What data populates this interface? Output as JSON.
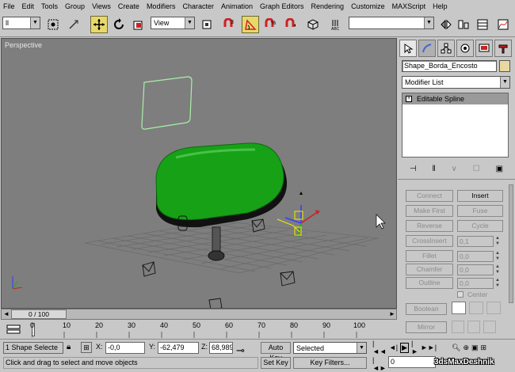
{
  "menu": [
    "File",
    "Edit",
    "Tools",
    "Group",
    "Views",
    "Create",
    "Modifiers",
    "Character",
    "Animation",
    "Graph Editors",
    "Rendering",
    "Customize",
    "MAXScript",
    "Help"
  ],
  "toolbar": {
    "selection_filter": "ll",
    "ref_coord": "View",
    "named_selection": ""
  },
  "viewport": {
    "label": "Perspective",
    "bg_color": "#7e7e7e",
    "seat_color": "#17a117"
  },
  "command_panel": {
    "object_name": "Shape_Borda_Encosto",
    "modifier_list": "Modifier List",
    "stack_item": "Editable Spline",
    "buttons": [
      {
        "label": "Connect",
        "enabled": false
      },
      {
        "label": "Insert",
        "enabled": true
      },
      {
        "label": "Make First",
        "enabled": false
      },
      {
        "label": "Fuse",
        "enabled": false
      },
      {
        "label": "Reverse",
        "enabled": false
      },
      {
        "label": "Cycle",
        "enabled": false
      },
      {
        "label": "CrossInsert",
        "enabled": false
      },
      {
        "label": "Fillet",
        "enabled": false
      },
      {
        "label": "Chamfer",
        "enabled": false
      },
      {
        "label": "Outline",
        "enabled": false
      },
      {
        "label": "Boolean",
        "enabled": false
      },
      {
        "label": "Mirror",
        "enabled": false
      }
    ],
    "crossinsert_value": "0,1",
    "fillet_value": "0,0",
    "chamfer_value": "0,0",
    "outline_value": "0,0",
    "center_label": "Center"
  },
  "timeline": {
    "frame_display": "0 / 100",
    "ticks": [
      "0",
      "10",
      "20",
      "30",
      "40",
      "50",
      "60",
      "70",
      "80",
      "90",
      "100"
    ]
  },
  "status": {
    "selection": "1 Shape Selecte",
    "prompt": "Click and drag to select and move objects",
    "x_label": "X:",
    "x_value": "-0,0",
    "y_label": "Y:",
    "y_value": "-62,479",
    "z_label": "Z:",
    "z_value": "68,989",
    "auto_key": "Auto Key",
    "set_key": "Set Key",
    "key_mode": "Selected",
    "key_filters": "Key Filters...",
    "current_frame": "0",
    "watermark": "3dsMaxDeshnik"
  }
}
